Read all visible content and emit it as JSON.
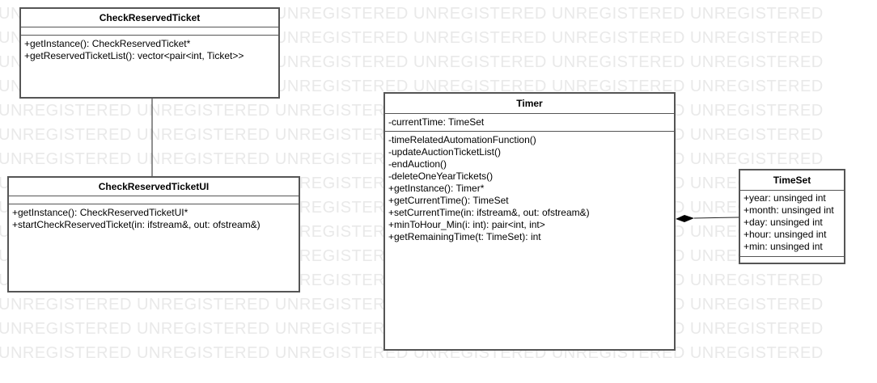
{
  "watermark": {
    "text": "UNREGISTERED UNREGISTERED UNREGISTERED UNREGISTERED UNREGISTERED UNREGISTERED"
  },
  "classes": {
    "check_reserved_ticket": {
      "name": "CheckReservedTicket",
      "attributes": [],
      "operations": [
        "+getInstance(): CheckReservedTicket*",
        "+getReservedTicketList(): vector<pair<int, Ticket>>"
      ]
    },
    "check_reserved_ticket_ui": {
      "name": "CheckReservedTicketUI",
      "attributes": [],
      "operations": [
        "+getInstance(): CheckReservedTicketUI*",
        "+startCheckReservedTicket(in: ifstream&, out: ofstream&)"
      ]
    },
    "timer": {
      "name": "Timer",
      "attributes": [
        "-currentTime: TimeSet"
      ],
      "operations": [
        "-timeRelatedAutomationFunction()",
        "-updateAuctionTicketList()",
        "-endAuction()",
        "-deleteOneYearTickets()",
        "+getInstance(): Timer*",
        "+getCurrentTime(): TimeSet",
        "+setCurrentTime(in: ifstream&, out: ofstream&)",
        "+minToHour_Min(i: int): pair<int, int>",
        "+getRemainingTime(t: TimeSet): int"
      ]
    },
    "time_set": {
      "name": "TimeSet",
      "attributes": [
        "+year: unsinged int",
        "+month: unsinged int",
        "+day: unsinged int",
        "+hour: unsinged int",
        "+min: unsinged int"
      ],
      "operations": []
    }
  },
  "relations": [
    {
      "from": "check_reserved_ticket",
      "to": "check_reserved_ticket_ui",
      "kind": "association"
    },
    {
      "from": "timer",
      "to": "time_set",
      "kind": "composition"
    }
  ],
  "colors": {
    "border": "#555555",
    "watermark": "#e9e9e9",
    "diamond": "#000000"
  }
}
